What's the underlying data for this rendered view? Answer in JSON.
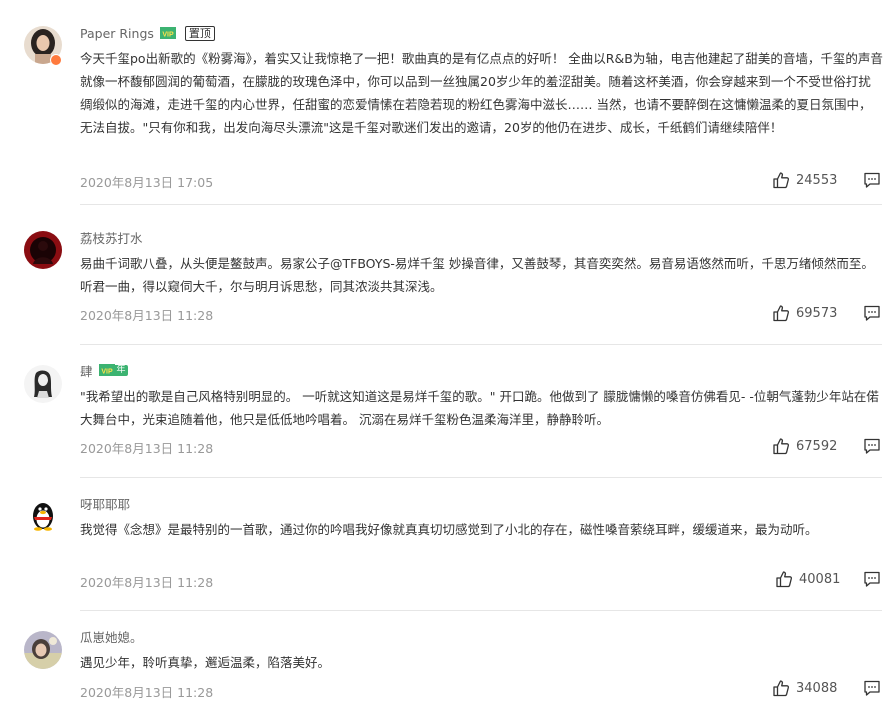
{
  "colors": {
    "text": "#333333",
    "username": "#666666",
    "timestamp": "#999999",
    "divider": "#e6e6e6",
    "vip_green": "#3cb371"
  },
  "icons": {
    "like": "thumbs-up-icon",
    "reply": "comment-bubble-icon",
    "vip": "vip-badge-icon"
  },
  "comments": [
    {
      "username": "Paper Rings",
      "vip_label": "VIP",
      "pin_label": "置顶",
      "text": "今天千玺po出新歌的《粉雾海》，着实又让我惊艳了一把！歌曲真的是有亿点点的好听！ 全曲以R&B为轴，电吉他建起了甜美的音墙，千玺的声音就像一杯馥郁圆润的葡萄酒，在朦胧的玫瑰色泽中，你可以品到一丝独属20岁少年的羞涩甜美。随着这杯美酒，你会穿越来到一个不受世俗打扰绸缎似的海滩，走进千玺的内心世界，任甜蜜的恋爱情愫在若隐若现的粉红色雾海中滋长…… 当然，也请不要醉倒在这慵懒温柔的夏日氛围中，无法自拔。\"只有你和我，出发向海尽头漂流\"这是千玺对歌迷们发出的邀请，20岁的他仍在进步、成长，千纸鹤们请继续陪伴！",
      "time": "2020年8月13日 17:05",
      "likes": "24553"
    },
    {
      "username": "荔枝苏打水",
      "text": "易曲千词歌八叠，从头便是鳌鼓声。易家公子@TFBOYS-易烊千玺 妙操音律，又善鼓琴，其音奕奕然。易音易语悠然而听，千思万绪倾然而至。听君一曲，得以窥伺大千，尔与明月诉思愁，同其浓淡共其深浅。",
      "time": "2020年8月13日 11:28",
      "likes": "69573"
    },
    {
      "username": "肆",
      "vip_label": "VIP",
      "vip_year": "年",
      "text": "\"我希望出的歌是自己风格特别明显的。 一听就这知道这是易烊千玺的歌。\" 开口跪。他做到了 朦胧慵懒的嗓音仿佛看见-  -位朝气蓬勃少年站在偌大舞台中，光束追随着他，他只是低低地吟唱着。 沉溺在易烊千玺粉色温柔海洋里，静静聆听。",
      "time": "2020年8月13日 11:28",
      "likes": "67592"
    },
    {
      "username": "呀耶耶耶",
      "text": "我觉得《念想》是最特别的一首歌，通过你的吟唱我好像就真真切切感觉到了小北的存在，磁性嗓音萦绕耳畔，缓缓道来，最为动听。",
      "time": "2020年8月13日 11:28",
      "likes": "40081"
    },
    {
      "username": "瓜崽她媳。",
      "text": "遇见少年，聆听真挚，邂逅温柔，陷落美好。",
      "time": "2020年8月13日 11:28",
      "likes": "34088"
    }
  ]
}
